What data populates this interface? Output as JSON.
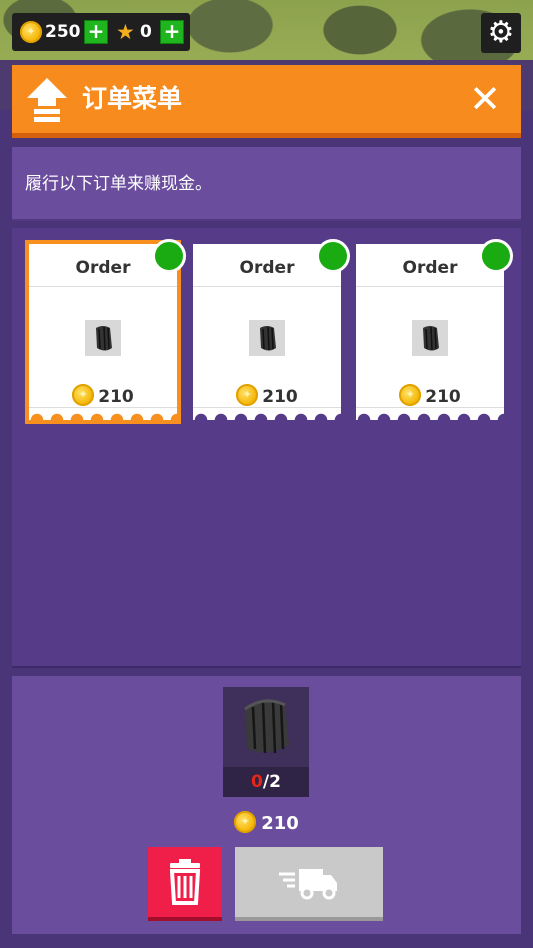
{
  "topbar": {
    "coins": "250",
    "stars": "0"
  },
  "header": {
    "title": "订单菜单",
    "close_symbol": "✕"
  },
  "description": "履行以下订单来赚现金。",
  "orders": [
    {
      "title": "Order",
      "price": "210",
      "item_icon": "tire-stack-icon",
      "fulfilled": true,
      "selected": true
    },
    {
      "title": "Order",
      "price": "210",
      "item_icon": "tire-stack-icon",
      "fulfilled": true,
      "selected": false
    },
    {
      "title": "Order",
      "price": "210",
      "item_icon": "tire-stack-icon",
      "fulfilled": true,
      "selected": false
    }
  ],
  "detail": {
    "item_icon": "tire-icon",
    "have": "0",
    "need": "/2",
    "reward": "210"
  },
  "colors": {
    "header_orange": "#f88b1e",
    "panel_purple": "#6a4d9c",
    "check_green": "#1aaa12",
    "delete_red": "#ef1f4a",
    "count_red": "#e5261a"
  }
}
